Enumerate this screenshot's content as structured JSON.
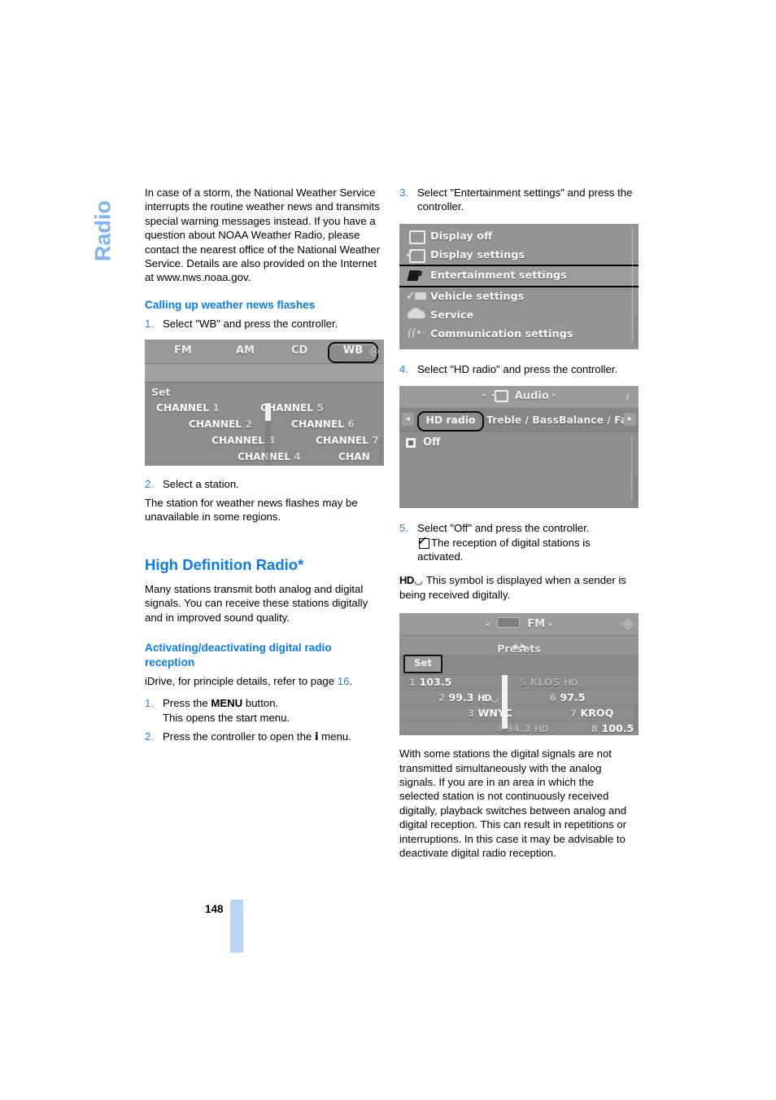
{
  "chapter": {
    "label": "Radio"
  },
  "page": {
    "number": "148"
  },
  "left": {
    "intro": "In case of a storm, the National Weather Service interrupts the routine weather news and transmits special warning messages instead. If you have a question about NOAA Weather Radio, please contact the nearest office of the National Weather Service. Details are also provided on the Internet at www.nws.noaa.gov.",
    "heading_weather": "Calling up weather news flashes",
    "step1_num": "1.",
    "step1_text": "Select \"WB\" and press the controller.",
    "step2_num": "2.",
    "step2_text": "Select a station.",
    "after_step2": "The station for weather news flashes may be unavailable in some regions.",
    "heading_hd": "High Definition Radio*",
    "hd_body": "Many stations transmit both analog and digital signals. You can receive these stations digitally and in improved sound quality.",
    "heading_activate": "Activating/deactivating digital radio reception",
    "idrive_ref_pre": "iDrive, for principle details, refer to page ",
    "idrive_ref_page": "16",
    "idrive_ref_post": ".",
    "a_step1_num": "1.",
    "a_step1_pre": "Press the ",
    "a_step1_bold": "MENU",
    "a_step1_post": " button.",
    "a_step1_sub": "This opens the start menu.",
    "a_step2_num": "2.",
    "a_step2_pre": "Press the controller to open the ",
    "a_step2_icon": "i",
    "a_step2_post": " menu."
  },
  "right": {
    "step3_num": "3.",
    "step3_text": "Select \"Entertainment settings\" and press the controller.",
    "step4_num": "4.",
    "step4_text": "Select \"HD radio\" and press the controller.",
    "step5_num": "5.",
    "step5_text": "Select \"Off\" and press the controller.",
    "step5_note": "The reception of digital stations is activated.",
    "hd_symbol_note": "This symbol is displayed when a sender is being received digitally.",
    "hd_symbol": "HD",
    "closing": "With some stations the digital signals are not transmitted simultaneously with the analog signals. If you are in an area in which the selected station is not continuously received digitally, playback switches between analog and digital reception. This can result in repetitions or interruptions. In this case it may be advisable to deactivate digital radio reception."
  },
  "shots": {
    "wb": {
      "tabs": [
        "FM",
        "AM",
        "CD"
      ],
      "selected_tab": "WB",
      "set_label": "Set",
      "channels_left": [
        {
          "name": "CHANNEL",
          "num": "1"
        },
        {
          "name": "CHANNEL",
          "num": "2"
        },
        {
          "name": "CHANNEL",
          "num": "3"
        },
        {
          "name": "CHANNEL",
          "num": "4"
        }
      ],
      "channels_right": [
        {
          "name": "CHANNEL",
          "num": "5"
        },
        {
          "name": "CHANNEL",
          "num": "6"
        },
        {
          "name": "CHANNEL",
          "num": "7"
        },
        {
          "name": "CHAN",
          "num": ""
        }
      ],
      "id_tag": "VSP8091mdA"
    },
    "menu": {
      "items": [
        {
          "label": "Display off",
          "icon": "square-icon",
          "selected": false
        },
        {
          "label": "Display settings",
          "icon": "check-square-icon",
          "selected": false
        },
        {
          "label": "Entertainment settings",
          "icon": "entertainment-icon",
          "selected": true
        },
        {
          "label": "Vehicle settings",
          "icon": "check-dashboard-icon",
          "selected": false
        },
        {
          "label": "Service",
          "icon": "car-icon",
          "selected": false
        },
        {
          "label": "Communication settings",
          "icon": "signal-waves-icon",
          "selected": false
        }
      ],
      "id_tag": "VS1E7D03TmdA"
    },
    "audio": {
      "title": "Audio",
      "selected_tab": "HD radio",
      "tabs": [
        "Treble / Bass",
        "Balance / Fad"
      ],
      "option": "Off",
      "id_tag": "VS1NAO9003N"
    },
    "fm": {
      "title": "FM",
      "subtitle": "Presets",
      "set_label": "Set",
      "presets_left": [
        {
          "num": "1",
          "name": "103.5",
          "hd": false
        },
        {
          "num": "2",
          "name": "99.3",
          "hd": true
        },
        {
          "num": "3",
          "name": "WNYC",
          "hd": false
        },
        {
          "num": "4",
          "name": "94.3",
          "hd": true
        }
      ],
      "presets_right": [
        {
          "num": "5",
          "name": "KLOS",
          "hd": true
        },
        {
          "num": "6",
          "name": "97.5",
          "hd": false
        },
        {
          "num": "7",
          "name": "KROQ",
          "hd": false
        },
        {
          "num": "8",
          "name": "100.5",
          "hd": false
        }
      ],
      "id_tag": "VSF9AF0705MA"
    }
  },
  "colors": {
    "accent_blue": "#0a7cf0",
    "step_blue": "#2f7fe0",
    "chapter_blue": "#7fb3f2",
    "page_bar": "#b9d5f7"
  }
}
